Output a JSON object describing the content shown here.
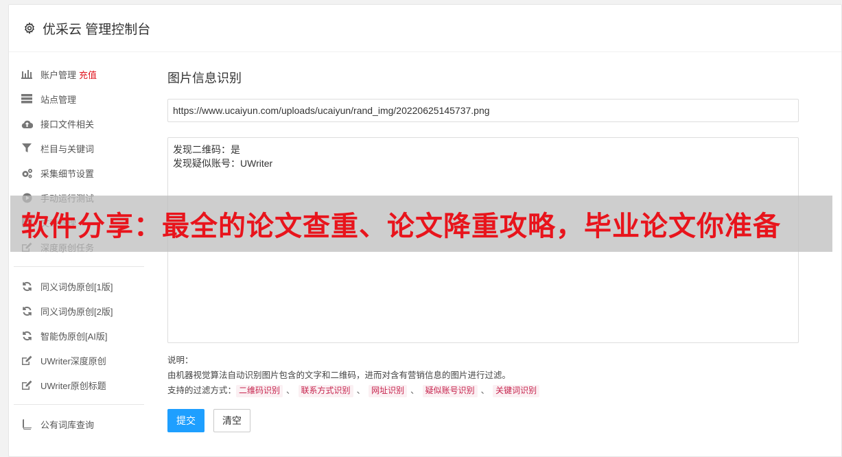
{
  "header": {
    "title": "优采云 管理控制台",
    "icon": "gear-icon"
  },
  "sidebar": {
    "items": [
      {
        "label": "账户管理",
        "badge": "充值",
        "icon": "bar-chart-icon"
      },
      {
        "label": "站点管理",
        "icon": "server-icon"
      },
      {
        "label": "接口文件相关",
        "icon": "cloud-upload-icon"
      },
      {
        "label": "栏目与关键词",
        "icon": "filter-icon"
      },
      {
        "label": "采集细节设置",
        "icon": "cogs-icon"
      },
      {
        "label": "手动运行测试",
        "icon": "play-circle-icon"
      },
      {
        "label": "文章管理",
        "icon": "list-icon"
      },
      {
        "label": "深度原创任务",
        "icon": "edit-icon"
      }
    ],
    "items2": [
      {
        "label": "同义词伪原创[1版]",
        "icon": "refresh-icon"
      },
      {
        "label": "同义词伪原创[2版]",
        "icon": "refresh-icon"
      },
      {
        "label": "智能伪原创[AI版]",
        "icon": "refresh-icon"
      },
      {
        "label": "UWriter深度原创",
        "icon": "edit-icon"
      },
      {
        "label": "UWriter原创标题",
        "icon": "edit-icon"
      }
    ],
    "items3": [
      {
        "label": "公有词库查询",
        "icon": "book-icon"
      }
    ]
  },
  "main": {
    "section_title": "图片信息识别",
    "url_value": "https://www.ucaiyun.com/uploads/ucaiyun/rand_img/20220625145737.png",
    "result_lines": [
      "发现二维码：是",
      "发现疑似账号：UWriter"
    ],
    "notes_label": "说明：",
    "notes_desc": "由机器视觉算法自动识别图片包含的文字和二维码，进而对含有营销信息的图片进行过滤。",
    "filter_label": "支持的过滤方式：",
    "filter_tags": [
      "二维码识别",
      "联系方式识别",
      "网址识别",
      "疑似账号识别",
      "关键词识别"
    ],
    "separator": "、",
    "submit_label": "提交",
    "clear_label": "清空"
  },
  "overlay": {
    "text": "软件分享：最全的论文查重、论文降重攻略，毕业论文你准备"
  },
  "colors": {
    "primary": "#1e9fff",
    "badge": "#e0141e",
    "tag_text": "#c7254e",
    "overlay_text": "#e8141c"
  }
}
